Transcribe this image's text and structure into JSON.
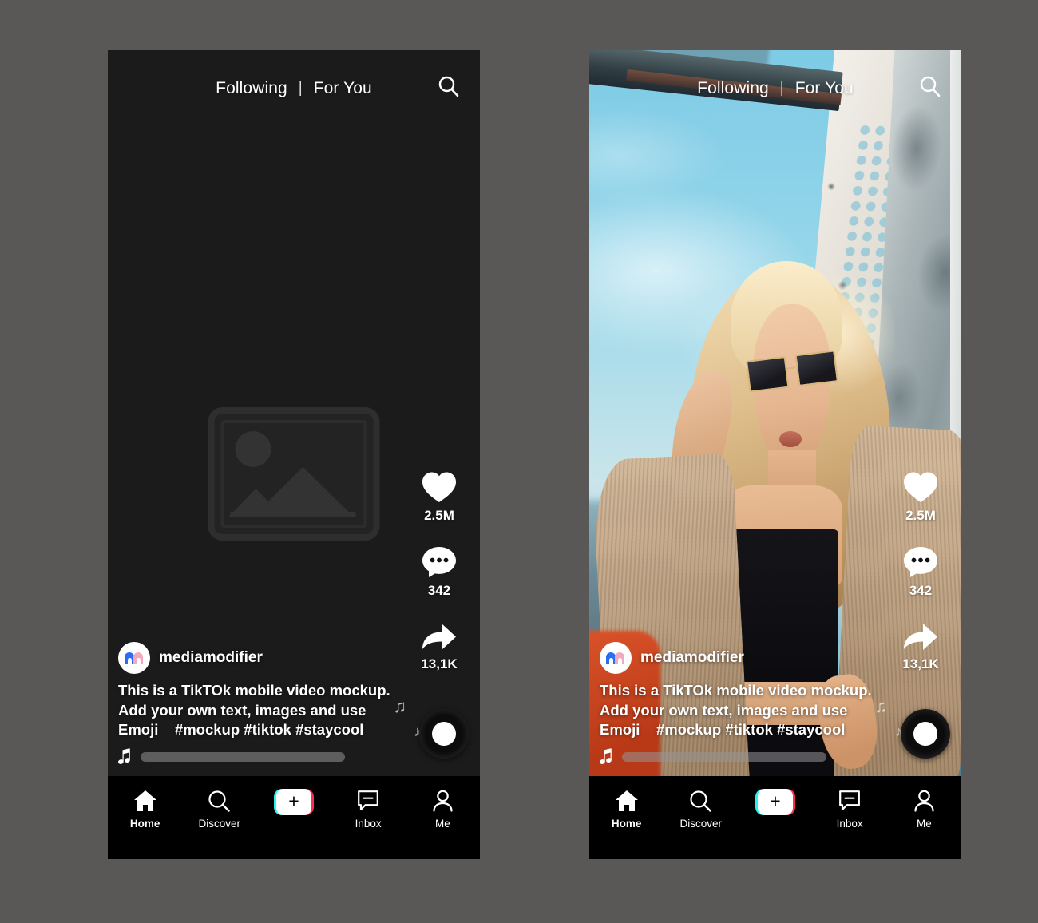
{
  "theme": {
    "background": "#5a5757",
    "screen_dark": "#191919",
    "nav_bar": "#000000",
    "accent_cyan": "#25f4ee",
    "accent_pink": "#fe2c55",
    "text_white": "#ffffff"
  },
  "header": {
    "tab_following": "Following",
    "separator": "|",
    "tab_for_you": "For You",
    "search_icon": "search-icon"
  },
  "actions": {
    "like": {
      "icon": "heart-icon",
      "count": "2.5M"
    },
    "comment": {
      "icon": "comment-bubble-icon",
      "count": "342"
    },
    "share": {
      "icon": "share-arrow-icon",
      "count": "13,1K"
    }
  },
  "post": {
    "avatar_icon": "mediamodifier-logo",
    "username": "mediamodifier",
    "caption_line_1": "This is a TikTOk mobile video mockup.",
    "caption_line_2": "Add your own text, images and use",
    "caption_line_3": "Emoji    #mockup #tiktok #staycool",
    "music_icon": "music-note-icon",
    "disc_icon": "vinyl-record-icon"
  },
  "navbar": {
    "items": [
      {
        "label": "Home",
        "icon": "home-icon",
        "active": true
      },
      {
        "label": "Discover",
        "icon": "search-icon",
        "active": false
      },
      {
        "label": "",
        "icon": "plus-icon",
        "active": false
      },
      {
        "label": "Inbox",
        "icon": "inbox-message-icon",
        "active": false
      },
      {
        "label": "Me",
        "icon": "person-icon",
        "active": false
      }
    ]
  },
  "left_phone": {
    "media_state": "placeholder",
    "placeholder_icon": "image-placeholder-icon"
  },
  "right_phone": {
    "media_state": "photo",
    "photo_description": "blonde-woman-sunglasses-corduroy-jacket"
  }
}
